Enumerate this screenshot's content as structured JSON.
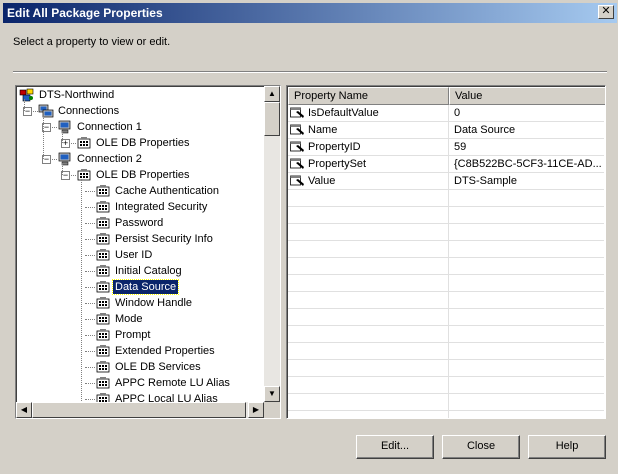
{
  "window": {
    "title": "Edit All Package Properties",
    "close_glyph": "✕"
  },
  "instruction": "Select a property to view or edit.",
  "tree": {
    "nodes": [
      {
        "label": "DTS-Northwind",
        "icon": "package-icon",
        "level": 0,
        "expander": ""
      },
      {
        "label": "Connections",
        "icon": "connections-icon",
        "level": 1,
        "expander": "−"
      },
      {
        "label": "Connection 1",
        "icon": "connection-icon",
        "level": 2,
        "expander": "−"
      },
      {
        "label": "OLE DB Properties",
        "icon": "property-group-icon",
        "level": 3,
        "expander": "+"
      },
      {
        "label": "Connection 2",
        "icon": "connection-icon",
        "level": 2,
        "expander": "−"
      },
      {
        "label": "OLE DB Properties",
        "icon": "property-group-icon",
        "level": 3,
        "expander": "−"
      },
      {
        "label": "Cache Authentication",
        "icon": "property-group-icon",
        "level": 4,
        "expander": ""
      },
      {
        "label": "Integrated Security",
        "icon": "property-group-icon",
        "level": 4,
        "expander": ""
      },
      {
        "label": "Password",
        "icon": "property-group-icon",
        "level": 4,
        "expander": ""
      },
      {
        "label": "Persist Security Info",
        "icon": "property-group-icon",
        "level": 4,
        "expander": ""
      },
      {
        "label": "User ID",
        "icon": "property-group-icon",
        "level": 4,
        "expander": ""
      },
      {
        "label": "Initial Catalog",
        "icon": "property-group-icon",
        "level": 4,
        "expander": ""
      },
      {
        "label": "Data Source",
        "icon": "property-group-icon",
        "level": 4,
        "expander": "",
        "selected": true
      },
      {
        "label": "Window Handle",
        "icon": "property-group-icon",
        "level": 4,
        "expander": ""
      },
      {
        "label": "Mode",
        "icon": "property-group-icon",
        "level": 4,
        "expander": ""
      },
      {
        "label": "Prompt",
        "icon": "property-group-icon",
        "level": 4,
        "expander": ""
      },
      {
        "label": "Extended Properties",
        "icon": "property-group-icon",
        "level": 4,
        "expander": ""
      },
      {
        "label": "OLE DB Services",
        "icon": "property-group-icon",
        "level": 4,
        "expander": ""
      },
      {
        "label": "APPC Remote LU Alias",
        "icon": "property-group-icon",
        "level": 4,
        "expander": ""
      },
      {
        "label": "APPC Local LU Alias",
        "icon": "property-group-icon",
        "level": 4,
        "expander": ""
      }
    ]
  },
  "grid": {
    "headers": [
      "Property Name",
      "Value"
    ],
    "rows": [
      {
        "name": "IsDefaultValue",
        "value": "0"
      },
      {
        "name": "Name",
        "value": "Data Source"
      },
      {
        "name": "PropertyID",
        "value": "59"
      },
      {
        "name": "PropertySet",
        "value": "{C8B522BC-5CF3-11CE-AD..."
      },
      {
        "name": "Value",
        "value": "DTS-Sample"
      }
    ],
    "empty_rows": 14
  },
  "buttons": {
    "edit": "Edit...",
    "close": "Close",
    "help": "Help"
  },
  "colors": {
    "title_bar_start": "#0a246a",
    "title_bar_end": "#a6caf0",
    "selection": "#0a246a",
    "face": "#d4d0c8"
  }
}
